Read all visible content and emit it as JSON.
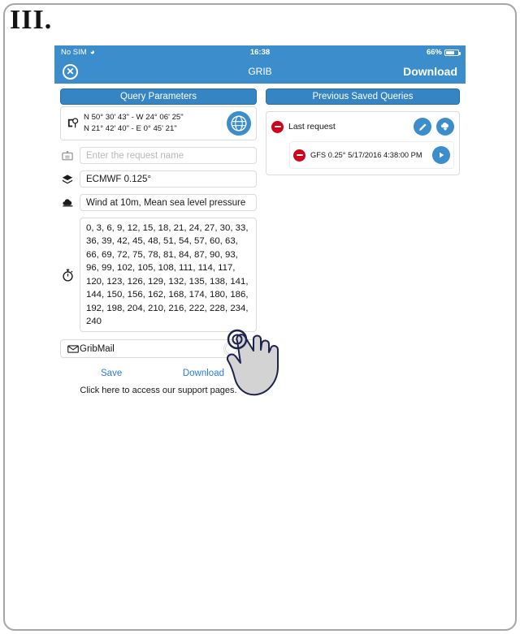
{
  "figure": {
    "label": "III."
  },
  "status_bar": {
    "carrier": "No SIM",
    "wifi_icon": "wifi-icon",
    "time": "16:38",
    "battery_percent": "66%",
    "battery_icon": "battery-icon"
  },
  "nav_bar": {
    "close_icon": "close-icon",
    "title": "GRIB",
    "download_label": "Download"
  },
  "tabs": {
    "query_parameters": "Query Parameters",
    "previous_saved_queries": "Previous Saved Queries"
  },
  "query_form": {
    "coordinates": {
      "icon": "map-pin-icon",
      "line1": "N 50° 30' 43\" - W 24° 06' 25\"",
      "line2": "N 21° 42' 40\" - E 0° 45' 21\"",
      "globe_icon": "globe-expand-icon"
    },
    "request_name": {
      "icon": "tag-icon",
      "value": "",
      "placeholder": "Enter the request name"
    },
    "model": {
      "icon": "layers-icon",
      "value": "ECMWF 0.125°"
    },
    "parameters": {
      "icon": "cloud-icon",
      "value": "Wind at 10m, Mean sea level pressure"
    },
    "timesteps": {
      "icon": "stopwatch-icon",
      "value": "0, 3, 6, 9, 12, 15, 18, 21, 24, 27, 30, 33, 36, 39, 42, 45, 48, 51, 54, 57, 60, 63, 66, 69, 72, 75, 78, 81, 84, 87, 90, 93, 96, 99, 102, 105, 108, 111, 114, 117, 120, 123, 126, 129, 132, 135, 138, 141, 144, 150, 156, 162, 168, 174, 180, 186, 192, 198, 204, 210, 216, 222, 228, 234, 240"
    },
    "gribmail": {
      "icon": "envelope-icon",
      "label": "GribMail",
      "enabled": false
    },
    "save_label": "Save",
    "download_label": "Download",
    "support_text": "Click here to access our support pages."
  },
  "saved_queries": [
    {
      "delete_icon": "delete-icon",
      "label": "Last request",
      "actions": [
        {
          "icon": "pencil-icon",
          "name": "edit-button"
        },
        {
          "icon": "cloud-download-icon",
          "name": "download-button"
        }
      ],
      "child": {
        "delete_icon": "delete-icon",
        "label": "GFS 0.25° 5/17/2016 4:38:00 PM",
        "action": {
          "icon": "play-icon",
          "name": "play-button"
        }
      }
    }
  ],
  "cursor": {
    "icon": "pointing-hand-cursor",
    "target": "Download"
  },
  "colors": {
    "brand_blue": "#3b8ecb",
    "tab_blue": "#3585c4",
    "link_blue": "#2a7ae2",
    "delete_red": "#d0021b",
    "frame_grey": "#a6a6a6"
  }
}
